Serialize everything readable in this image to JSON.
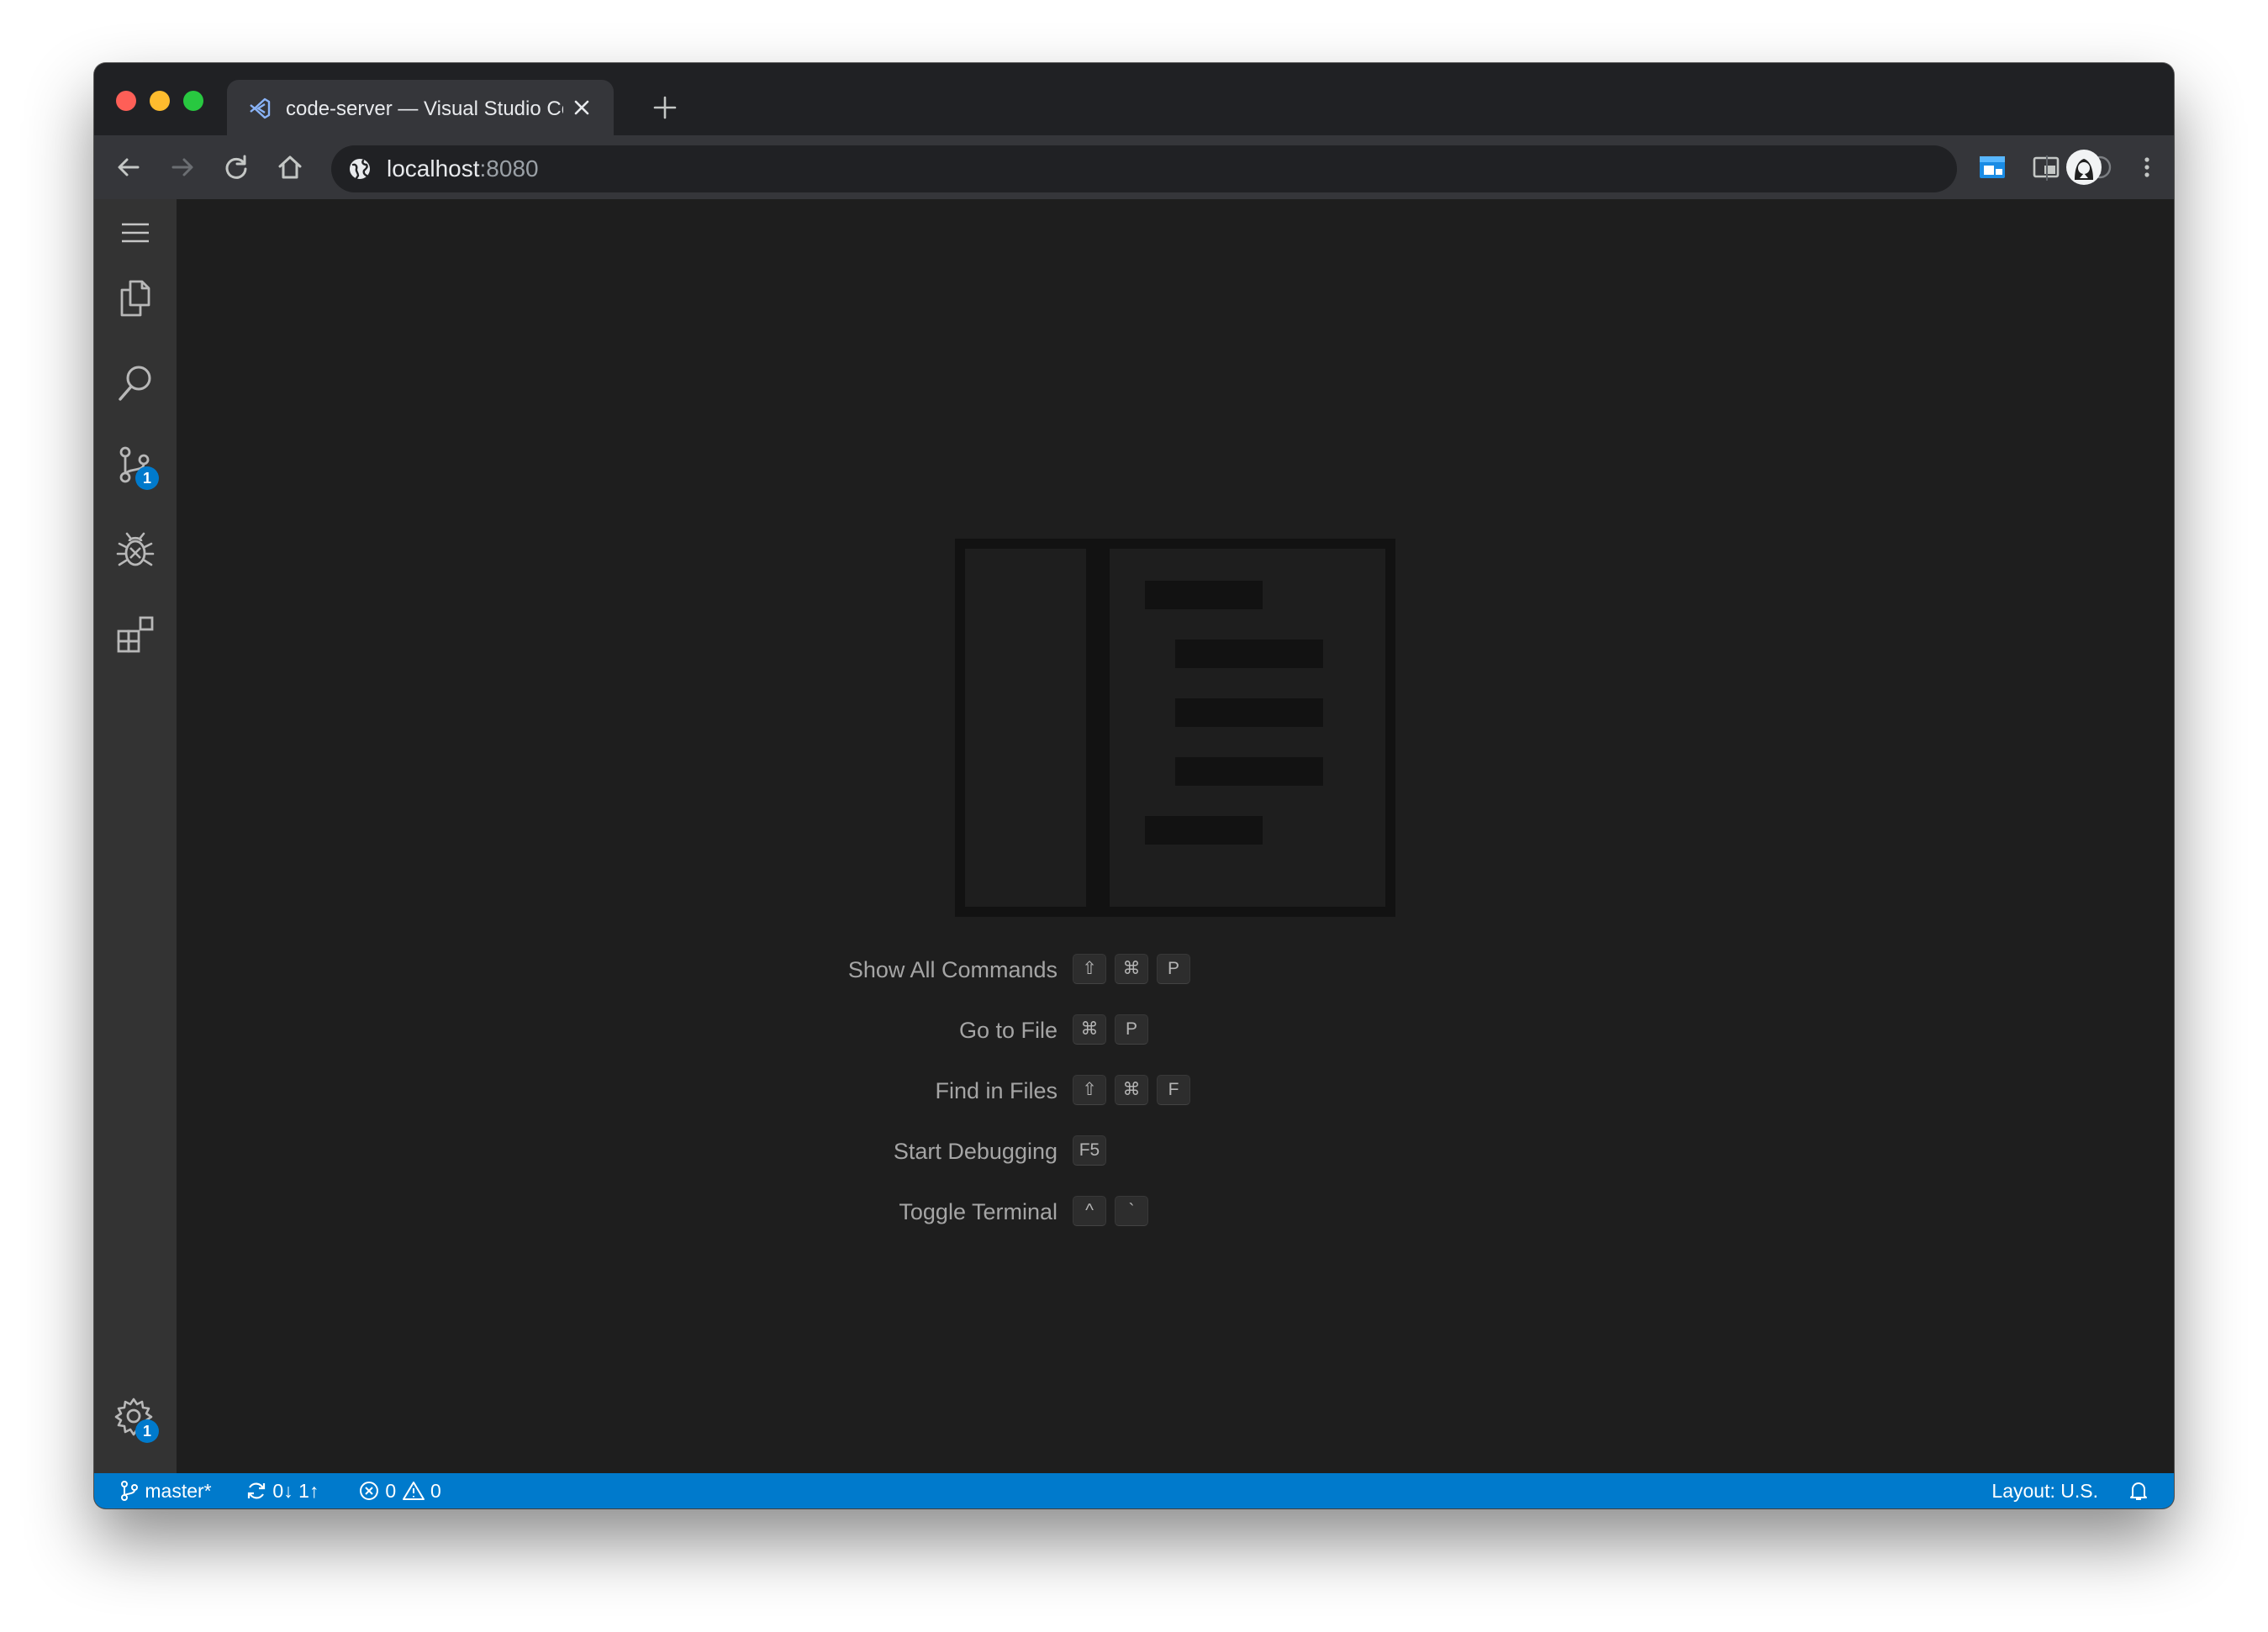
{
  "browser": {
    "tab_title": "code-server — Visual Studio Code",
    "tab_favicon": "vscode-favicon-icon",
    "url_host": "localhost",
    "url_port": ":8080",
    "icons": {
      "back": "arrow-left-icon",
      "forward": "arrow-right-icon",
      "reload": "reload-icon",
      "home": "home-icon",
      "site_info": "globe-icon",
      "extension_1": "blue-extension-icon",
      "extension_2": "picture-in-picture-icon",
      "extension_3": "info-icon",
      "profile": "avatar-icon",
      "menu": "kebab-menu-icon"
    }
  },
  "activity_bar": {
    "items": [
      {
        "name": "menu",
        "icon": "hamburger-icon"
      },
      {
        "name": "explorer",
        "icon": "files-icon"
      },
      {
        "name": "search",
        "icon": "search-icon"
      },
      {
        "name": "source-control",
        "icon": "git-branch-icon",
        "badge": "1"
      },
      {
        "name": "debug",
        "icon": "bug-icon"
      },
      {
        "name": "extensions",
        "icon": "extensions-icon"
      }
    ],
    "manage": {
      "icon": "gear-icon",
      "badge": "1"
    }
  },
  "editor": {
    "shortcuts": [
      {
        "label": "Show All Commands",
        "keys": [
          "⇧",
          "⌘",
          "P"
        ]
      },
      {
        "label": "Go to File",
        "keys": [
          "⌘",
          "P"
        ]
      },
      {
        "label": "Find in Files",
        "keys": [
          "⇧",
          "⌘",
          "F"
        ]
      },
      {
        "label": "Start Debugging",
        "keys": [
          "F5"
        ]
      },
      {
        "label": "Toggle Terminal",
        "keys": [
          "^",
          "`"
        ]
      }
    ]
  },
  "status_bar": {
    "branch": "master*",
    "sync": "0↓ 1↑",
    "errors": "0",
    "warnings": "0",
    "layout": "Layout: U.S.",
    "color": "#007acc"
  }
}
